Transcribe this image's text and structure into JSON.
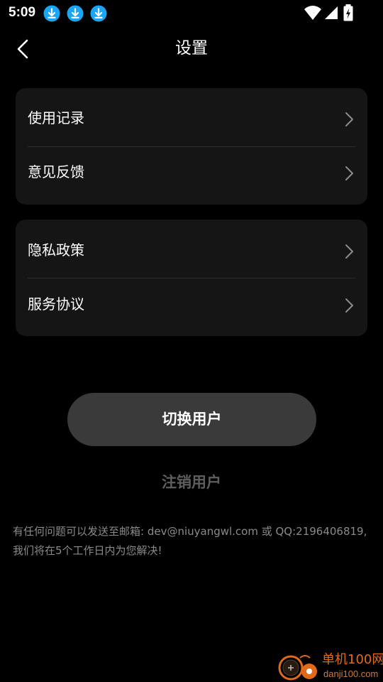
{
  "status_bar": {
    "time": "5:09",
    "notification_icons": [
      "download-icon",
      "download-icon",
      "download-icon"
    ],
    "indicator_icons": [
      "wifi-icon",
      "signal-icon",
      "battery-charging-icon"
    ],
    "accent_color": "#1aa6f5"
  },
  "nav": {
    "title": "设置",
    "back_icon": "chevron-left-icon"
  },
  "groups": [
    {
      "items": [
        {
          "label": "使用记录"
        },
        {
          "label": "意见反馈"
        }
      ]
    },
    {
      "items": [
        {
          "label": "隐私政策"
        },
        {
          "label": "服务协议"
        }
      ]
    }
  ],
  "actions": {
    "switch_user": "切换用户",
    "logout": "注销用户"
  },
  "footer": {
    "note": "有任何问题可以发送至邮箱: dev@niuyangwl.com 或 QQ:2196406819,我们将在5个工作日内为您解决!"
  },
  "watermark": {
    "name": "单机100网",
    "domain": "danji100.com"
  },
  "colors": {
    "background": "#000000",
    "card": "#151515",
    "button": "#3a3a3a",
    "muted_text": "#5e5e5e",
    "footer_text": "#8a8a8a",
    "watermark": "#e06a1a"
  }
}
